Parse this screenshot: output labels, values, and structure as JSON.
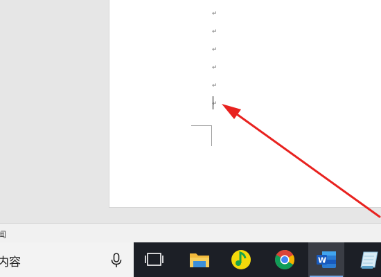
{
  "document": {
    "paragraph_mark": "↵",
    "paragraph_count": 6
  },
  "status_bar": {
    "text": "闻"
  },
  "taskbar": {
    "search_text": "内容",
    "apps": [
      {
        "name": "task-view",
        "active": false
      },
      {
        "name": "file-explorer",
        "active": false
      },
      {
        "name": "qq-music",
        "active": false
      },
      {
        "name": "chrome",
        "active": false
      },
      {
        "name": "word",
        "active": true
      },
      {
        "name": "notepad",
        "active": false
      }
    ]
  },
  "annotation": {
    "arrow_color": "#e8221f"
  }
}
